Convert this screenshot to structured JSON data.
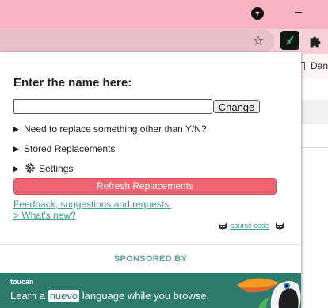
{
  "browser": {
    "bookmark_label": "Dan",
    "colors": {
      "titlebar": "#f9b4c4",
      "toolbar": "#f6cfd8",
      "omnibox": "#e6c1c9"
    },
    "icons": [
      "profile-dropdown-icon",
      "minimize-icon",
      "bookmark-star-icon",
      "extension-icon",
      "puzzle-icon",
      "folder-icon"
    ]
  },
  "popup": {
    "prompt": "Enter the name here:",
    "name_input": {
      "value": "",
      "placeholder": ""
    },
    "change_label": "Change",
    "sections": [
      {
        "label": "Need to replace something other than Y/N?"
      },
      {
        "label": "Stored Replacements"
      },
      {
        "label": "Settings",
        "icon": "gear-icon"
      }
    ],
    "refresh_label": "Refresh Replacements",
    "links": {
      "feedback": "Feedback, suggestions and requests.",
      "whats_new": "> What's new?",
      "source_code": "source code"
    },
    "sponsored_label": "SPONSORED BY",
    "ad": {
      "brand": "toucan",
      "text_before": "Learn a ",
      "highlight": "nuevo",
      "text_after": " language while you browse."
    },
    "colors": {
      "accent": "#ef6470",
      "link": "#3f9f9c",
      "ad_bg": "#2e7b6e",
      "sponsored": "#5aa3a0"
    }
  }
}
